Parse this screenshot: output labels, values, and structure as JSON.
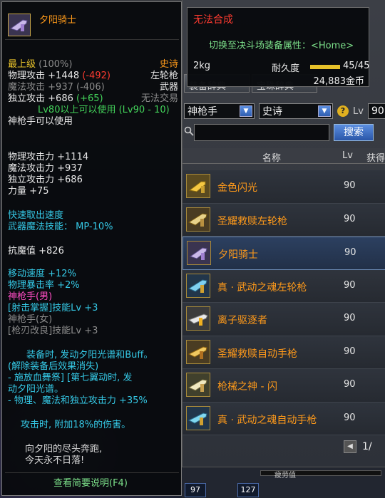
{
  "compare": {
    "title": "无法合成",
    "switch_text": "切换至决斗场装备属性：<Home>",
    "weight": "2kg",
    "durability_label": "耐久度",
    "durability_value": "45/45",
    "durability_fraction": 1.0,
    "price": "24,883金币"
  },
  "shop": {
    "tabs": [
      "装备辞典",
      "宝珠辞典"
    ],
    "job_select": "神枪手",
    "rarity_select": "史诗",
    "lv_label": "Lv",
    "lv_value": "90",
    "search_button": "搜索",
    "header": {
      "name": "名称",
      "lv": "Lv",
      "get": "获得"
    },
    "items": [
      {
        "name": "金色闪光",
        "lv": "90"
      },
      {
        "name": "圣耀救赎左轮枪",
        "lv": "90"
      },
      {
        "name": "夕阳骑士",
        "lv": "90"
      },
      {
        "name": "真 · 武动之魂左轮枪",
        "lv": "90"
      },
      {
        "name": "离子驱逐者",
        "lv": "90"
      },
      {
        "name": "圣耀救赎自动手枪",
        "lv": "90"
      },
      {
        "name": "枪械之神 - 闪",
        "lv": "90"
      },
      {
        "name": "真 · 武动之魂自动手枪",
        "lv": "90"
      }
    ],
    "page": "1/",
    "xp_label": "疲劳值",
    "badges": [
      "97",
      "127"
    ]
  },
  "tooltip": {
    "title": "夕阳骑士",
    "grade": "最上级",
    "grade_pct": "(100%)",
    "rarity": "史诗",
    "weapon_type": "左轮枪",
    "category": "武器",
    "trade": "无法交易",
    "phys_atk_label": "物理攻击",
    "phys_atk_val": "+1448",
    "phys_atk_diff": "(-492)",
    "mag_atk_label": "魔法攻击",
    "mag_atk_val": "+937",
    "mag_atk_diff": "(-406)",
    "ind_atk_label": "独立攻击",
    "ind_atk_val": "+686",
    "ind_atk_diff": "(+65)",
    "lv_req": "Lv80以上可以使用 (Lv90 - 10)",
    "class_req": "神枪手可以使用",
    "stats": [
      "物理攻击力 +1114",
      "魔法攻击力 +937",
      "独立攻击力 +686",
      "力量 +75"
    ],
    "quick_draw": "快速取出速度",
    "magic_skill": "武器魔法技能： MP-10%",
    "elem_res": "抗魔值 +826",
    "move_speed": "移动速度 +12%",
    "phys_crit": "物理暴击率 +2%",
    "class_male": "神枪手(男)",
    "skill_male": "[射击掌握]技能Lv +3",
    "class_female": "神枪手(女)",
    "skill_female": "[枪刃改良]技能Lv +3",
    "set_desc": [
      "装备时, 发动夕阳光谱和Buff。",
      "(解除装备后效果消失)",
      "- 施放血舞祭] [第七翼动时, 发",
      "动夕阳光谱。",
      "- 物理、魔法和独立攻击力 +35%",
      "",
      "攻击时, 附加18%的伤害。"
    ],
    "flavor": [
      "向夕阳的尽头奔跑,",
      "今天永不日落!"
    ],
    "summary_button": "查看简要说明(F4)"
  },
  "colors": {
    "epic": "#ff9a1a",
    "warning": "#ff3b30",
    "bonus": "#43d35a",
    "option": "#35c9e6",
    "class": "#ff4dc4"
  }
}
